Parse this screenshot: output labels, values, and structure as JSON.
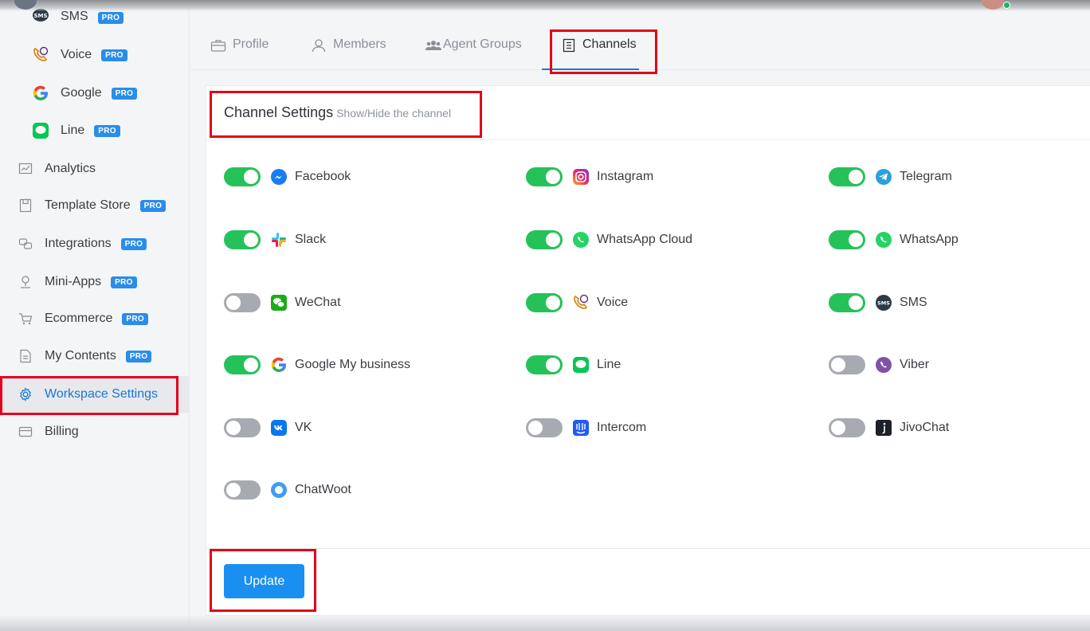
{
  "sidebar": {
    "items": [
      {
        "label": "SMS",
        "pro": "PRO",
        "icon": "sms-icon"
      },
      {
        "label": "Voice",
        "pro": "PRO",
        "icon": "voice-icon"
      },
      {
        "label": "Google",
        "pro": "PRO",
        "icon": "google-icon"
      },
      {
        "label": "Line",
        "pro": "PRO",
        "icon": "line-icon"
      },
      {
        "label": "Analytics",
        "icon": "analytics-icon"
      },
      {
        "label": "Template Store",
        "pro": "PRO",
        "icon": "template-store-icon"
      },
      {
        "label": "Integrations",
        "pro": "PRO",
        "icon": "integrations-icon"
      },
      {
        "label": "Mini-Apps",
        "pro": "PRO",
        "icon": "mini-apps-icon"
      },
      {
        "label": "Ecommerce",
        "pro": "PRO",
        "icon": "cart-icon"
      },
      {
        "label": "My Contents",
        "pro": "PRO",
        "icon": "document-icon"
      },
      {
        "label": "Workspace Settings",
        "icon": "gear-icon"
      },
      {
        "label": "Billing",
        "icon": "card-icon"
      }
    ]
  },
  "tabs": [
    {
      "label": "Profile",
      "icon": "briefcase-icon"
    },
    {
      "label": "Members",
      "icon": "user-icon"
    },
    {
      "label": "Agent Groups",
      "icon": "users-icon"
    },
    {
      "label": "Channels",
      "icon": "list-icon"
    }
  ],
  "channel_settings": {
    "title": "Channel Settings",
    "subtitle": "Show/Hide the channel"
  },
  "channels": [
    {
      "name": "Facebook",
      "enabled": true,
      "icon": "messenger-icon"
    },
    {
      "name": "Instagram",
      "enabled": true,
      "icon": "instagram-icon"
    },
    {
      "name": "Telegram",
      "enabled": true,
      "icon": "telegram-icon"
    },
    {
      "name": "Slack",
      "enabled": true,
      "icon": "slack-icon"
    },
    {
      "name": "WhatsApp Cloud",
      "enabled": true,
      "icon": "whatsapp-icon"
    },
    {
      "name": "WhatsApp",
      "enabled": true,
      "icon": "whatsapp-icon"
    },
    {
      "name": "WeChat",
      "enabled": false,
      "icon": "wechat-icon"
    },
    {
      "name": "Voice",
      "enabled": true,
      "icon": "voice-icon"
    },
    {
      "name": "SMS",
      "enabled": true,
      "icon": "sms-icon"
    },
    {
      "name": "Google My business",
      "enabled": true,
      "icon": "google-icon"
    },
    {
      "name": "Line",
      "enabled": true,
      "icon": "line-icon"
    },
    {
      "name": "Viber",
      "enabled": false,
      "icon": "viber-icon"
    },
    {
      "name": "VK",
      "enabled": false,
      "icon": "vk-icon"
    },
    {
      "name": "Intercom",
      "enabled": false,
      "icon": "intercom-icon"
    },
    {
      "name": "JivoChat",
      "enabled": false,
      "icon": "jivochat-icon"
    },
    {
      "name": "ChatWoot",
      "enabled": false,
      "icon": "chatwoot-icon"
    }
  ],
  "update_button": "Update",
  "colors": {
    "accent": "#1a8ff2",
    "toggle_on": "#25c25a",
    "toggle_off": "#a7abb1",
    "highlight": "#e3001b"
  }
}
